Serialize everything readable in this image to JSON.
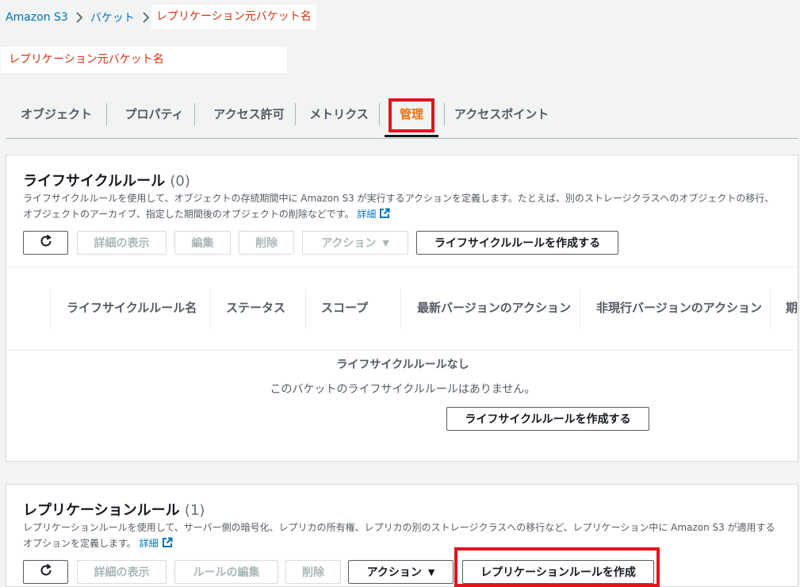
{
  "breadcrumb": {
    "root": "Amazon S3",
    "buckets": "バケット",
    "current": "レプリケーション元バケット名"
  },
  "page_title": "レプリケーション元バケット名",
  "tabs": [
    {
      "label": "オブジェクト"
    },
    {
      "label": "プロパティ"
    },
    {
      "label": "アクセス許可"
    },
    {
      "label": "メトリクス"
    },
    {
      "label": "管理",
      "active": true
    },
    {
      "label": "アクセスポイント"
    }
  ],
  "lifecycle": {
    "title": "ライフサイクルルール",
    "count": "(0)",
    "description_line1": "ライフサイクルルールを使用して、オブジェクトの存続期間中に Amazon S3 が実行するアクションを定義します。たとえば、別のストレージクラスへのオブジェクトの移行、",
    "description_line2": "オブジェクトのアーカイブ、指定した期間後のオブジェクトの削除などです。",
    "learn_more": "詳細",
    "buttons": {
      "view_details": "詳細の表示",
      "edit": "編集",
      "delete": "削除",
      "actions": "アクション",
      "create": "ライフサイクルルールを作成する"
    },
    "columns": [
      "ライフサイクルルール名",
      "ステータス",
      "スコープ",
      "最新バージョンのアクション",
      "非現行バージョンのアクション",
      "期"
    ],
    "empty_title": "ライフサイクルルールなし",
    "empty_desc": "このバケットのライフサイクルルールはありません。",
    "empty_create": "ライフサイクルルールを作成する"
  },
  "replication": {
    "title": "レプリケーションルール",
    "count": "(1)",
    "description_line1": "レプリケーションルールを使用して、サーバー側の暗号化、レプリカの所有権、レプリカの別のストレージクラスへの移行など、レプリケーション中に Amazon S3 が適用する",
    "description_line2": "オプションを定義します。",
    "learn_more": "詳細",
    "buttons": {
      "view_details": "詳細の表示",
      "edit_rule": "ルールの編集",
      "delete": "削除",
      "actions": "アクション",
      "create": "レプリケーションルールを作成"
    }
  },
  "colors": {
    "link": "#0073bb",
    "highlight_text": "#d13212",
    "active_tab": "#ec7211",
    "annotation_outline": "#e0141e"
  }
}
